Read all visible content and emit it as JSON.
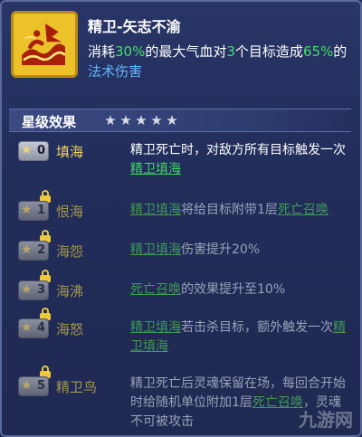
{
  "skill": {
    "icon": "water-wave-bird-icon",
    "title": "精卫-矢志不渝",
    "desc_1": "消耗",
    "desc_pct1": "30%",
    "desc_2": "的最大气血对",
    "desc_count": "3",
    "desc_3": "个目标造成",
    "desc_pct2": "65%",
    "desc_4": "的",
    "desc_type": "法术伤害"
  },
  "section": {
    "title": "星级效果",
    "star_icon": "star-icon",
    "stars_count": 5
  },
  "rows": [
    {
      "level": "0",
      "name": "填海",
      "locked": false,
      "d1": "精卫死亡时，对敌方所有目标触发一次",
      "link": "精卫填海",
      "d2": ""
    },
    {
      "level": "1",
      "name": "恨海",
      "locked": true,
      "d1": "",
      "link": "精卫填海",
      "d2": "将给目标附带1层",
      "link2": "死亡召唤"
    },
    {
      "level": "2",
      "name": "海怨",
      "locked": true,
      "d1": "",
      "link": "精卫填海",
      "d2": "伤害提升20%"
    },
    {
      "level": "3",
      "name": "海沸",
      "locked": true,
      "d1": "",
      "link": "死亡召唤",
      "d2": "的效果提升至10%"
    },
    {
      "level": "4",
      "name": "海怒",
      "locked": true,
      "d1": "",
      "link": "精卫填海",
      "d2": "若击杀目标，额外触发一次",
      "link2": "精卫填海"
    },
    {
      "level": "5",
      "name": "精卫鸟",
      "locked": true,
      "d1": "精卫死亡后灵魂保留在场，每回合开始时给随机单位附加1层",
      "link": "死亡召唤",
      "d2": "，灵魂不可被攻击"
    }
  ],
  "watermark": "九游网",
  "colors": {
    "accent_green": "#44e06a",
    "accent_blue": "#5fb8ff",
    "name_gold": "#f2d45c"
  }
}
